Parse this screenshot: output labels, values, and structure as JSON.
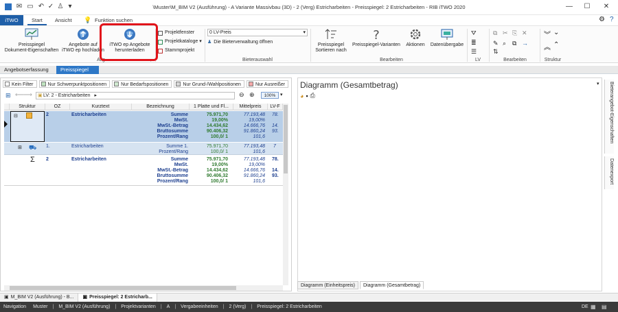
{
  "title_bar": {
    "title": "\\Muster\\M_BIM V2 (Ausführung) - A Variante Massivbau (3D) - 2 (Verg) Estricharbeiten - Preisspiegel: 2 Estricharbeiten - RIB iTWO 2020"
  },
  "ribbon_tabs": {
    "app": "iTWO",
    "start": "Start",
    "view": "Ansicht",
    "search": "Funktion suchen"
  },
  "ribbon": {
    "btn_preisspiegel_props": "Preisspiegel\nDokument-Eigenschaften",
    "btn_upload_offers": "Angebote auf\niTWO ep hochladen",
    "btn_download_offers": "iTWO ep Angebote\nherunterladen",
    "group_allg": "Allg",
    "projektfenster": "Projektfenster",
    "projektkataloge": "Projektkataloge",
    "stammprojekt": "Stammprojekt",
    "lv_combo": "0 LV-Preis",
    "bieterverwaltung": "Die Bieterverwaltung öffnen",
    "group_bieterauswahl": "Bieterauswahl",
    "sort_btn": "Preisspiegel\nSortieren nach",
    "variants_btn": "Preisspiegel-Varianten",
    "actions_btn": "Aktionen",
    "data_transfer_btn": "Datenübergabe",
    "group_bearbeiten1": "Bearbeiten",
    "group_lv": "LV",
    "group_bearbeiten2": "Bearbeiten",
    "group_struktur": "Struktur"
  },
  "doc_tabs": {
    "tab1": "Angebotserfassung",
    "tab2": "Preisspiegel"
  },
  "filters": [
    {
      "label": "Kein Filter",
      "color": "#ffffff"
    },
    {
      "label": "Nur Schwerpunktpositionen",
      "color": "#bfe3bf"
    },
    {
      "label": "Nur Bedarfspositionen",
      "color": "#cfe8cf"
    },
    {
      "label": "Nur Grund-/Wahlpositionen",
      "color": "#d7d7d7"
    },
    {
      "label": "Nur Ausreißer",
      "color": "#f2a7a7"
    }
  ],
  "navigation": {
    "lv": "LV: 2 - Estricharbeiten",
    "zoom": "100%"
  },
  "grid": {
    "headers": [
      "Struktur",
      "OZ",
      "Kurztext",
      "Bezeichnung",
      "1 Platte und Fl...",
      "Mittelpreis",
      "LV-F"
    ],
    "row1": {
      "oz": "2",
      "kurztext": "Estricharbeiten",
      "labels": [
        "Summe",
        "MwSt.",
        "MwSt.-Betrag",
        "Bruttosumme",
        "Prozent/Rang"
      ],
      "col1": [
        "75.971,70",
        "19,00%",
        "14.434,62",
        "90.406,32",
        "100,0/ 1"
      ],
      "col2": [
        "77.193,48",
        "19,00%",
        "14.666,76",
        "91.860,24",
        "101,6"
      ],
      "col3": [
        "78.",
        "",
        "14.",
        "93.",
        ""
      ]
    },
    "row2": {
      "oz": "1.",
      "kurztext": "Estricharbeiten",
      "labels": [
        "Summe 1.",
        "Prozent/Rang"
      ],
      "col1": [
        "75.971,70",
        "100,0/ 1"
      ],
      "col2": [
        "77.193,48",
        "101,6"
      ],
      "col3": [
        "7",
        ""
      ]
    },
    "row3": {
      "oz": "2",
      "kurztext": "Estricharbeiten",
      "labels": [
        "Summe",
        "MwSt.",
        "MwSt.-Betrag",
        "Bruttosumme",
        "Prozent/Rang"
      ],
      "col1": [
        "75.971,70",
        "19,00%",
        "14.434,62",
        "90.406,32",
        "100,0/ 1"
      ],
      "col2": [
        "77.193,48",
        "19,00%",
        "14.666,76",
        "91.860,24",
        "101,6"
      ],
      "col3": [
        "78.",
        "",
        "14.",
        "93.",
        ""
      ]
    }
  },
  "chart_panel": {
    "title": "Diagramm (Gesamtbetrag)",
    "tab1": "Diagramm (Einheitspreis)",
    "tab2": "Diagramm (Gesamtbetrag)"
  },
  "side_tabs": {
    "tab1": "Bieterangebot-Eigenschaften",
    "tab2": "Datenexport"
  },
  "window_tabs": {
    "tab1": "M_BIM V2 (Ausführung) - B...",
    "tab2": "Preisspiegel: 2 Estricharb..."
  },
  "status_bar": {
    "navigation": "Navigation",
    "crumbs": [
      "Muster",
      "M_BIM V2 (Ausführung)",
      "Projektvarianten",
      "A",
      "Vergabeeinheiten",
      "2 (Verg)",
      "Preisspiegel: 2 Estricharbeiten"
    ],
    "lang": "DE"
  },
  "colors": {
    "accent": "#1f5fa8",
    "highlight": "#e1141a",
    "row_selected": "#b8cfe8"
  }
}
